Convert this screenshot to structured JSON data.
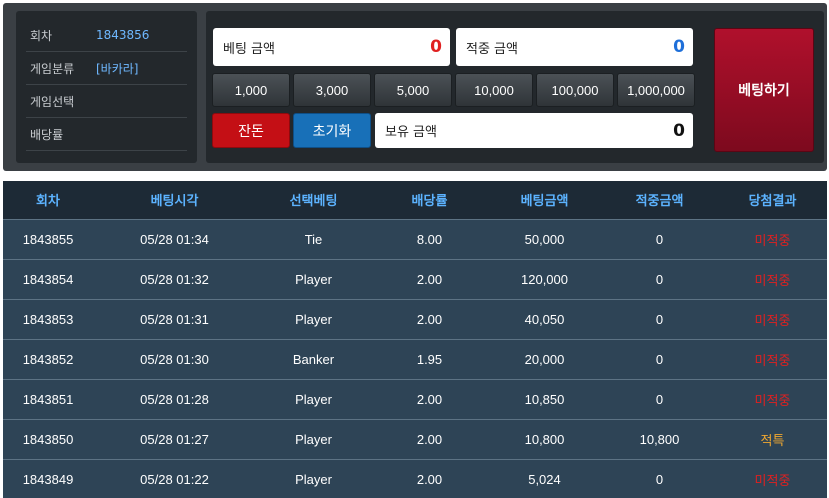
{
  "info": {
    "rows": [
      {
        "label": "회차",
        "value": "1843856"
      },
      {
        "label": "게임분류",
        "value": "[바카라]"
      },
      {
        "label": "게임선택",
        "value": ""
      },
      {
        "label": "배당률",
        "value": ""
      }
    ]
  },
  "bet": {
    "bet_amount_label": "베팅 금액",
    "bet_amount_value": "0",
    "win_amount_label": "적중 금액",
    "win_amount_value": "0",
    "chips": [
      "1,000",
      "3,000",
      "5,000",
      "10,000",
      "100,000",
      "1,000,000"
    ],
    "change_label": "잔돈",
    "reset_label": "초기화",
    "balance_label": "보유 금액",
    "balance_value": "0",
    "bet_button_label": "베팅하기"
  },
  "history": {
    "headers": [
      "회차",
      "베팅시각",
      "선택베팅",
      "배당률",
      "베팅금액",
      "적중금액",
      "당첨결과"
    ],
    "rows": [
      {
        "round": "1843855",
        "time": "05/28 01:34",
        "pick": "Tie",
        "odds": "8.00",
        "bet": "50,000",
        "win": "0",
        "result": "미적중"
      },
      {
        "round": "1843854",
        "time": "05/28 01:32",
        "pick": "Player",
        "odds": "2.00",
        "bet": "120,000",
        "win": "0",
        "result": "미적중"
      },
      {
        "round": "1843853",
        "time": "05/28 01:31",
        "pick": "Player",
        "odds": "2.00",
        "bet": "40,050",
        "win": "0",
        "result": "미적중"
      },
      {
        "round": "1843852",
        "time": "05/28 01:30",
        "pick": "Banker",
        "odds": "1.95",
        "bet": "20,000",
        "win": "0",
        "result": "미적중"
      },
      {
        "round": "1843851",
        "time": "05/28 01:28",
        "pick": "Player",
        "odds": "2.00",
        "bet": "10,850",
        "win": "0",
        "result": "미적중"
      },
      {
        "round": "1843850",
        "time": "05/28 01:27",
        "pick": "Player",
        "odds": "2.00",
        "bet": "10,800",
        "win": "10,800",
        "result": "적특"
      },
      {
        "round": "1843849",
        "time": "05/28 01:22",
        "pick": "Player",
        "odds": "2.00",
        "bet": "5,024",
        "win": "0",
        "result": "미적중"
      }
    ]
  }
}
